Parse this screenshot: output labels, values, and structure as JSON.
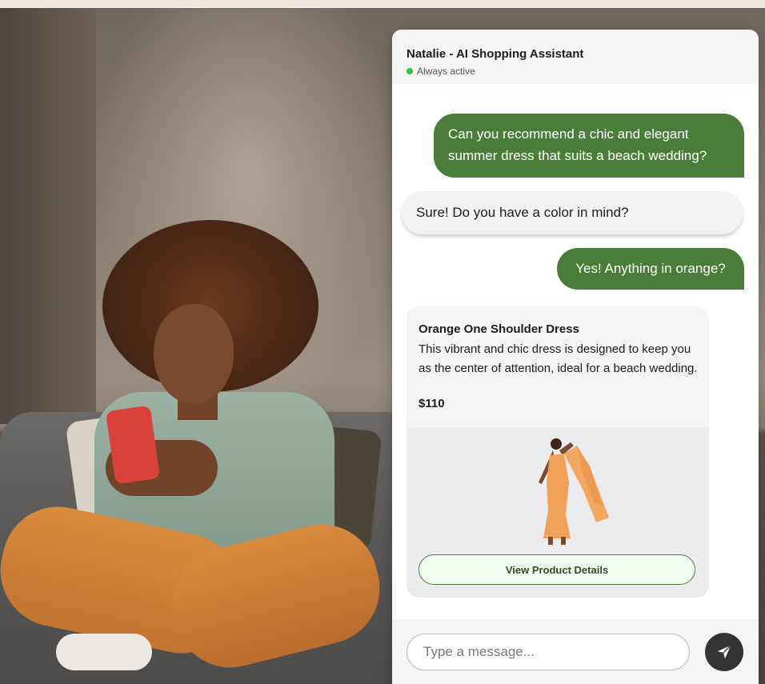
{
  "chat": {
    "agent_name": "Natalie - AI Shopping Assistant",
    "status_text": "Always active",
    "status_color": "#37c13c",
    "accent_color": "#4b7d3a"
  },
  "messages": [
    {
      "sender": "user",
      "text": "Can you recommend a chic and elegant summer dress that suits a beach wedding?"
    },
    {
      "sender": "assistant",
      "text": "Sure! Do you have a color in mind?"
    },
    {
      "sender": "user",
      "text": "Yes! Anything in orange?"
    }
  ],
  "product": {
    "title": "Orange One Shoulder Dress",
    "description": "This vibrant and chic dress is designed to keep you as the center of attention, ideal for a beach wedding.",
    "price": "$110",
    "button_label": "View Product Details",
    "color": "#f1a05a"
  },
  "composer": {
    "placeholder": "Type a message...",
    "send_icon": "send-icon"
  }
}
